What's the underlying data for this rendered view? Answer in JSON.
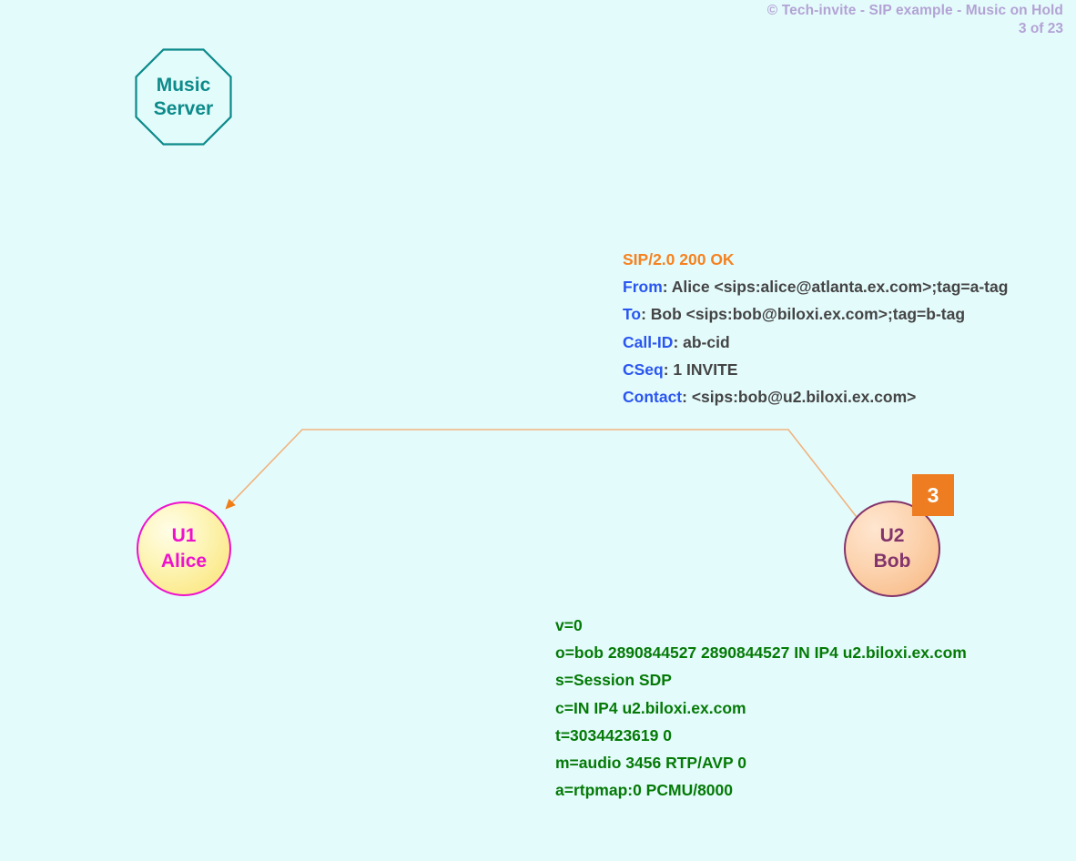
{
  "header": {
    "copyright": "© Tech-invite - SIP example - Music on Hold",
    "page_indicator": "3 of 23",
    "text_color": "#b3a3d4"
  },
  "nodes": {
    "music_server": {
      "line1": "Music",
      "line2": "Server",
      "shape": "octagon",
      "border_color": "#0d8a8a",
      "fill_color": "#e2fbfb",
      "text_color": "#0d8a8a"
    },
    "u1": {
      "line1": "U1",
      "line2": "Alice",
      "shape": "circle",
      "border_color": "#ee11cc",
      "fill_color": "#fbea8e",
      "text_color": "#ee11cc"
    },
    "u2": {
      "line1": "U2",
      "line2": "Bob",
      "shape": "circle",
      "border_color": "#83346b",
      "fill_color": "#f8bb88",
      "text_color": "#83346b"
    }
  },
  "step_badge": {
    "number": "3",
    "background_color": "#ed7d20",
    "text_color": "#ffffff"
  },
  "arrow": {
    "color": "#ee8822",
    "direction": "u2-to-u1",
    "label": "SIP 200 OK from Bob to Alice"
  },
  "sip_message": {
    "start_line": "SIP/2.0 200 OK",
    "start_line_color": "#f58220",
    "header_name_color": "#2a56f0",
    "header_value_color": "#444444",
    "headers": [
      {
        "name": "From",
        "value": ": Alice <sips:alice@atlanta.ex.com>;tag=a-tag"
      },
      {
        "name": "To",
        "value": ": Bob <sips:bob@biloxi.ex.com>;tag=b-tag"
      },
      {
        "name": "Call-ID",
        "value": ": ab-cid"
      },
      {
        "name": "CSeq",
        "value": ": 1 INVITE"
      },
      {
        "name": "Contact",
        "value": ": <sips:bob@u2.biloxi.ex.com>"
      }
    ]
  },
  "sdp_body": {
    "color": "#047a06",
    "lines": [
      "v=0",
      "o=bob  2890844527  2890844527  IN  IP4  u2.biloxi.ex.com",
      "s=Session SDP",
      "c=IN  IP4  u2.biloxi.ex.com",
      "t=3034423619  0",
      "m=audio  3456  RTP/AVP  0",
      "a=rtpmap:0  PCMU/8000"
    ]
  }
}
